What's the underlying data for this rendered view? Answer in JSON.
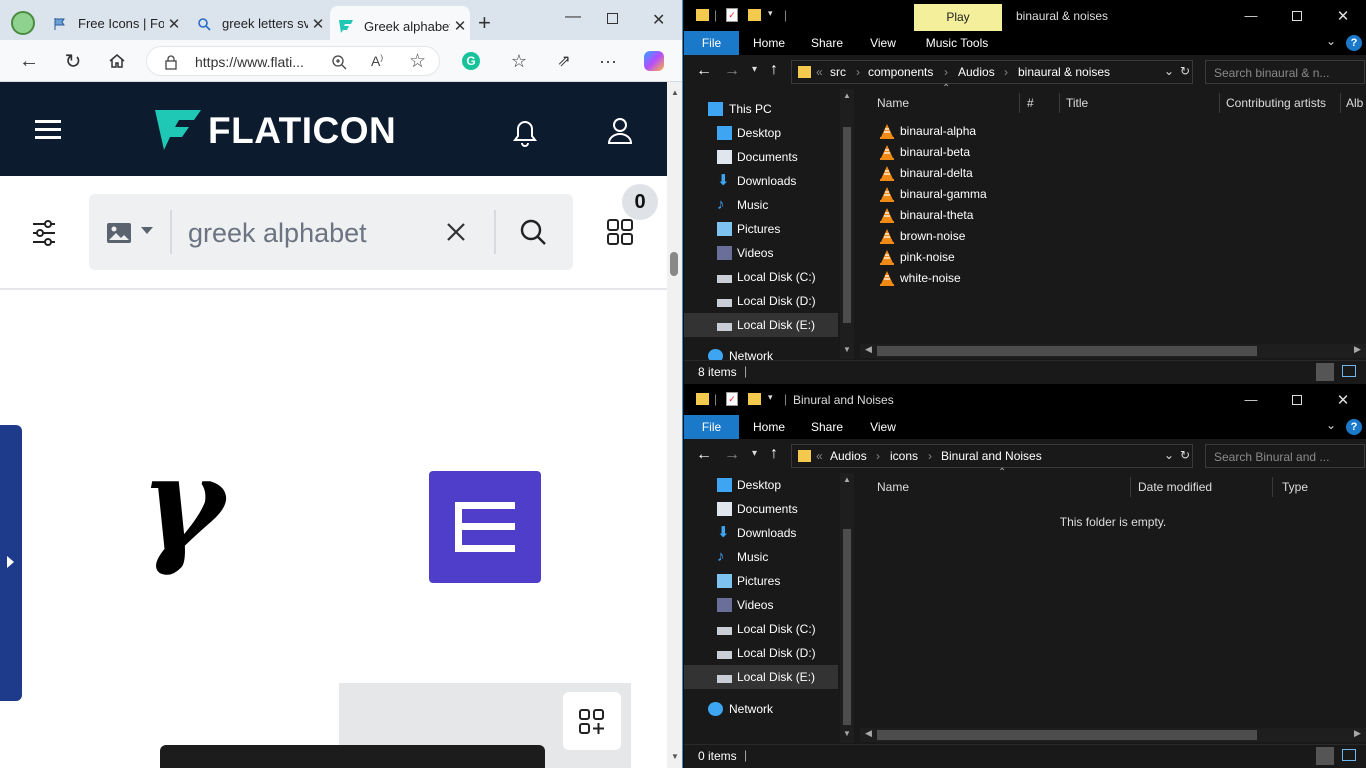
{
  "browser": {
    "tabs": [
      {
        "title": "Free Icons | For"
      },
      {
        "title": "greek letters sv"
      },
      {
        "title": "Greek alphabet"
      }
    ],
    "url": "https://www.flati..."
  },
  "flaticon": {
    "logo": "FLATICON",
    "search_value": "greek alphabet",
    "collection_count": "0",
    "gamma_glyph": "γ"
  },
  "explorer_top": {
    "title": "binaural & noises",
    "context_tab": "Play",
    "ribbon": {
      "file": "File",
      "home": "Home",
      "share": "Share",
      "view": "View",
      "music_tools": "Music Tools"
    },
    "breadcrumb": [
      "src",
      "components",
      "Audios",
      "binaural & noises"
    ],
    "search_placeholder": "Search binaural & n...",
    "nav": [
      "This PC",
      "Desktop",
      "Documents",
      "Downloads",
      "Music",
      "Pictures",
      "Videos",
      "Local Disk (C:)",
      "Local Disk (D:)",
      "Local Disk (E:)",
      "Network"
    ],
    "columns": [
      "Name",
      "#",
      "Title",
      "Contributing artists",
      "Alb"
    ],
    "files": [
      "binaural-alpha",
      "binaural-beta",
      "binaural-delta",
      "binaural-gamma",
      "binaural-theta",
      "brown-noise",
      "pink-noise",
      "white-noise"
    ],
    "status": "8 items"
  },
  "explorer_bottom": {
    "title": "Binural and Noises",
    "ribbon": {
      "file": "File",
      "home": "Home",
      "share": "Share",
      "view": "View"
    },
    "breadcrumb": [
      "Audios",
      "icons",
      "Binural and Noises"
    ],
    "search_placeholder": "Search Binural and ...",
    "nav": [
      "Desktop",
      "Documents",
      "Downloads",
      "Music",
      "Pictures",
      "Videos",
      "Local Disk (C:)",
      "Local Disk (D:)",
      "Local Disk (E:)",
      "Network"
    ],
    "columns": [
      "Name",
      "Date modified",
      "Type"
    ],
    "empty_message": "This folder is empty.",
    "status": "0 items"
  }
}
